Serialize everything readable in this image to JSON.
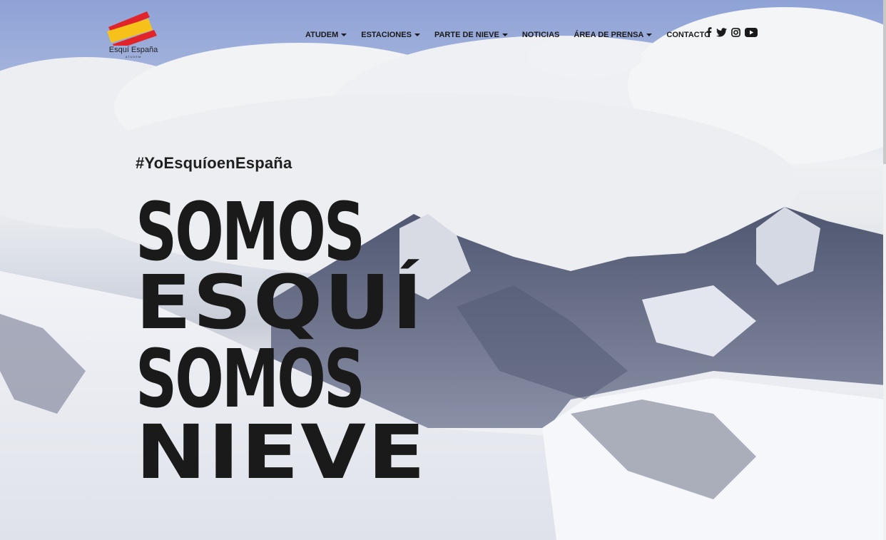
{
  "brand": {
    "name": "Esquí España",
    "tagline": "ATUDEM",
    "colors": {
      "red": "#e1232a",
      "yellow": "#f6c21a"
    }
  },
  "nav": {
    "items": [
      {
        "label": "ATUDEM",
        "has_dropdown": true
      },
      {
        "label": "ESTACIONES",
        "has_dropdown": true
      },
      {
        "label": "PARTE DE NIEVE",
        "has_dropdown": true
      },
      {
        "label": "NOTICIAS",
        "has_dropdown": false
      },
      {
        "label": "ÁREA DE PRENSA",
        "has_dropdown": true
      },
      {
        "label": "CONTACTO",
        "has_dropdown": false
      }
    ],
    "social": [
      "facebook-icon",
      "twitter-icon",
      "instagram-icon",
      "youtube-icon"
    ]
  },
  "hero": {
    "hashtag": "#YoEsquíoenEspaña",
    "line1": "SOMOS",
    "line2": "ESQUÍ",
    "line3": "SOMOS",
    "line4": "NIEVE",
    "text_color": "#1a1a1a"
  }
}
